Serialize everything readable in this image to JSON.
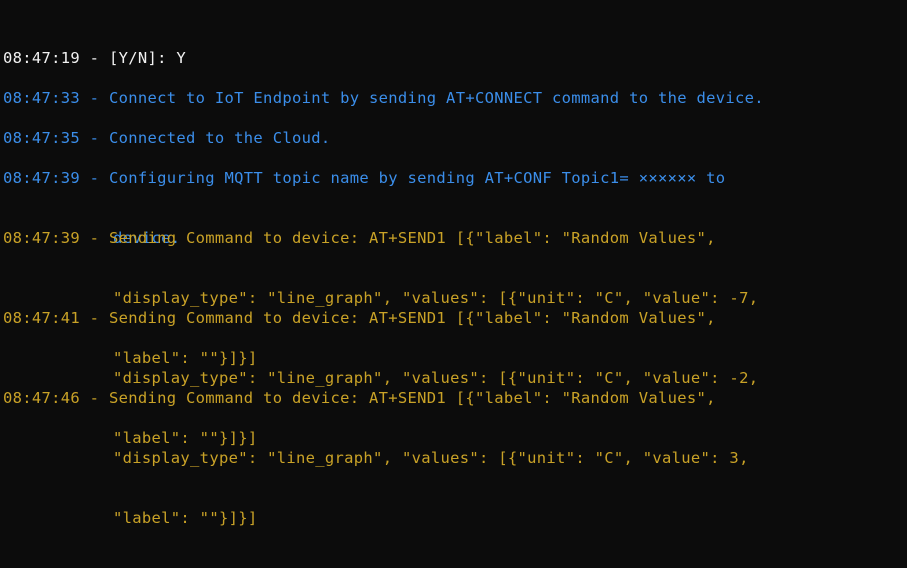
{
  "colors": {
    "background": "#0c0c0c",
    "white_text": "#f2f2f2",
    "info_blue": "#3b8eea",
    "command_yellow": "#c9a227"
  },
  "entries": [
    {
      "kind": "prompt",
      "color": "white",
      "lines": [
        "08:47:19 - [Y/N]: Y"
      ]
    },
    {
      "kind": "info",
      "color": "blue",
      "lines": [
        "08:47:33 - Connect to IoT Endpoint by sending AT+CONNECT command to the device."
      ]
    },
    {
      "kind": "info",
      "color": "blue",
      "lines": [
        "08:47:35 - Connected to the Cloud."
      ]
    },
    {
      "kind": "info",
      "color": "blue",
      "lines": [
        "08:47:39 - Configuring MQTT topic name by sending AT+CONF Topic1= ×××××× to",
        "device."
      ]
    },
    {
      "kind": "command",
      "color": "yellow",
      "lines": [
        "08:47:39 - Sending Command to device: AT+SEND1 [{\"label\": \"Random Values\",",
        "\"display_type\": \"line_graph\", \"values\": [{\"unit\": \"C\", \"value\": -7,",
        "\"label\": \"\"}]}]"
      ]
    },
    {
      "kind": "command",
      "color": "yellow",
      "lines": [
        "08:47:41 - Sending Command to device: AT+SEND1 [{\"label\": \"Random Values\",",
        "\"display_type\": \"line_graph\", \"values\": [{\"unit\": \"C\", \"value\": -2,",
        "\"label\": \"\"}]}]"
      ]
    },
    {
      "kind": "command",
      "color": "yellow",
      "lines": [
        "08:47:46 - Sending Command to device: AT+SEND1 [{\"label\": \"Random Values\",",
        "\"display_type\": \"line_graph\", \"values\": [{\"unit\": \"C\", \"value\": 3,",
        "\"label\": \"\"}]}]"
      ]
    }
  ]
}
